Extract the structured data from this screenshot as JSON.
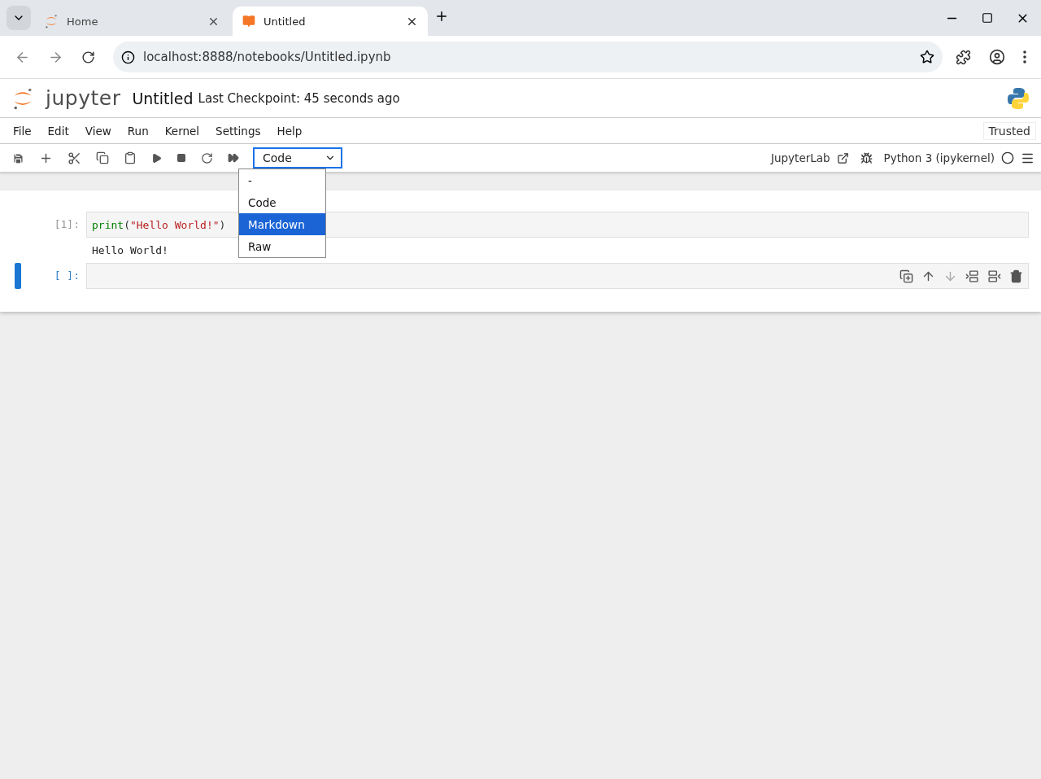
{
  "browser": {
    "tabs": [
      {
        "title": "Home",
        "kind": "jupyter",
        "selected": false
      },
      {
        "title": "Untitled",
        "kind": "notebook",
        "selected": true
      }
    ],
    "url": "localhost:8888/notebooks/Untitled.ipynb"
  },
  "header": {
    "logo": "jupyter",
    "title": "Untitled",
    "checkpoint": "Last Checkpoint: 45 seconds ago",
    "trusted": "Trusted"
  },
  "menu": [
    "File",
    "Edit",
    "View",
    "Run",
    "Kernel",
    "Settings",
    "Help"
  ],
  "toolbar": {
    "cell_type": "Code",
    "dropdown": {
      "expanded": true,
      "options": [
        {
          "label": "-",
          "selected": false
        },
        {
          "label": "Code",
          "selected": false
        },
        {
          "label": "Markdown",
          "selected": true
        },
        {
          "label": "Raw",
          "selected": false
        }
      ]
    },
    "link": "JupyterLab",
    "kernel": "Python 3 (ipykernel)"
  },
  "cells": [
    {
      "prompt": "[1]:",
      "active": false,
      "code": [
        {
          "kind": "builtin",
          "text": "print"
        },
        {
          "kind": "punct",
          "text": "("
        },
        {
          "kind": "string",
          "text": "\"Hello World!\""
        },
        {
          "kind": "punct",
          "text": ")"
        }
      ],
      "output": "Hello World!"
    },
    {
      "prompt": "[ ]:",
      "active": true
    }
  ]
}
